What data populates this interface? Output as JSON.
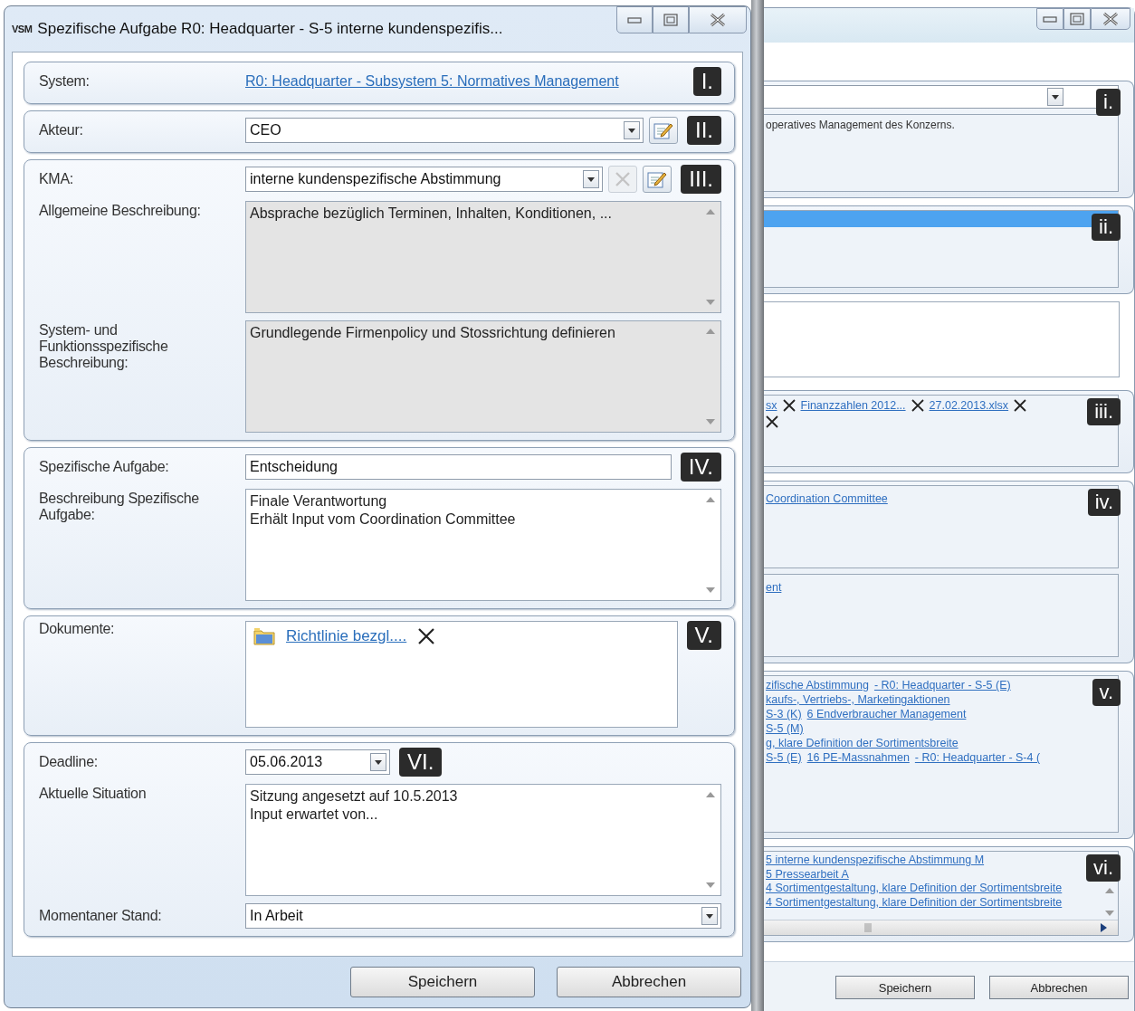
{
  "dialog": {
    "app_icon": "VSM",
    "title": "Spezifische Aufgabe R0: Headquarter - S-5 interne kundenspezifis...",
    "groups": [
      {
        "badge": "I.",
        "rows": [
          {
            "kind": "link",
            "label": "System:",
            "value": "R0: Headquarter - Subsystem 5: Normatives Management"
          }
        ]
      },
      {
        "badge": "II.",
        "rows": [
          {
            "kind": "combo",
            "label": "Akteur:",
            "value": "CEO",
            "buttons": [
              {
                "kind": "edit",
                "disabled": false
              }
            ]
          }
        ]
      },
      {
        "badge": "III.",
        "rows": [
          {
            "kind": "combo",
            "label": "KMA:",
            "value": "interne kundenspezifische Abstimmung",
            "buttons": [
              {
                "kind": "remove",
                "disabled": true
              },
              {
                "kind": "edit",
                "disabled": false
              }
            ]
          },
          {
            "kind": "textarea",
            "label": "Allgemeine Beschreibung:",
            "lines": [
              "Absprache bezüglich Terminen, Inhalten, Konditionen, ..."
            ],
            "disabled": true
          },
          {
            "kind": "textarea",
            "label": "System- und Funktionsspezifische Beschreibung:",
            "lines": [
              "Grundlegende Firmenpolicy und Stossrichtung definieren"
            ],
            "disabled": true
          }
        ]
      },
      {
        "badge": "IV.",
        "rows": [
          {
            "kind": "field",
            "label": "Spezifische Aufgabe:",
            "value": "Entscheidung"
          },
          {
            "kind": "textarea",
            "label": "Beschreibung Spezifische Aufgabe:",
            "lines": [
              "Finale Verantwortung",
              "Erhält Input vom Coordination Committee"
            ],
            "disabled": false
          }
        ]
      },
      {
        "badge": "V.",
        "rows": [
          {
            "kind": "documents",
            "label": "Dokumente:",
            "items": [
              {
                "name": "Richtlinie bezgl...."
              }
            ]
          }
        ]
      },
      {
        "badge": "VI.",
        "rows": [
          {
            "kind": "date",
            "label": "Deadline:",
            "value": "05.06.2013"
          },
          {
            "kind": "textarea",
            "label": "Aktuelle Situation",
            "lines": [
              "Sitzung angesetzt auf 10.5.2013",
              "Input erwartet von..."
            ],
            "disabled": false
          },
          {
            "kind": "combo",
            "label": "Momentaner Stand:",
            "value": "In Arbeit",
            "buttons": []
          }
        ]
      }
    ],
    "buttons": [
      "Speichern",
      "Abbrechen"
    ]
  },
  "background_window": {
    "panels": [
      {
        "kind": "combo_note",
        "badge": "i.",
        "note": "operatives Management des Konzerns."
      },
      {
        "kind": "list",
        "badge": "ii.",
        "rows": [
          {
            "selected": true
          }
        ]
      },
      {
        "kind": "blank"
      },
      {
        "kind": "files",
        "badge": "iii.",
        "lines": [
          [
            {
              "kind": "file",
              "name": "sx"
            },
            {
              "kind": "file",
              "name": "Finanzzahlen 2012..."
            },
            {
              "kind": "file",
              "name": "27.02.2013.xlsx"
            }
          ],
          [
            {
              "kind": "remove"
            }
          ]
        ]
      },
      {
        "kind": "link_boxes",
        "badge": "iv.",
        "boxes": [
          [
            "Coordination Committee"
          ],
          [
            "ent"
          ]
        ]
      },
      {
        "kind": "link_lines",
        "badge": "v.",
        "lines": [
          [
            "zifische Abstimmung",
            "- R0: Headquarter - S-5 (E)"
          ],
          [
            "kaufs-, Vertriebs-, Marketingaktionen"
          ],
          [
            "S-3 (K)",
            "6 Endverbraucher Management"
          ],
          [
            "S-5 (M)"
          ],
          [
            "g, klare Definition der Sortimentsbreite"
          ],
          [
            "S-5 (E)",
            "16 PE-Massnahmen",
            "- R0: Headquarter - S-4 ("
          ]
        ]
      },
      {
        "kind": "scroll_list",
        "badge": "vi.",
        "items": [
          "5 interne kundenspezifische Abstimmung M",
          "5 Pressearbeit A",
          "4 Sortimentgestaltung, klare Definition der Sortimentsbreite",
          "4 Sortimentgestaltung, klare Definition der Sortimentsbreite"
        ]
      }
    ],
    "buttons": [
      "Speichern",
      "Abbrechen"
    ]
  }
}
